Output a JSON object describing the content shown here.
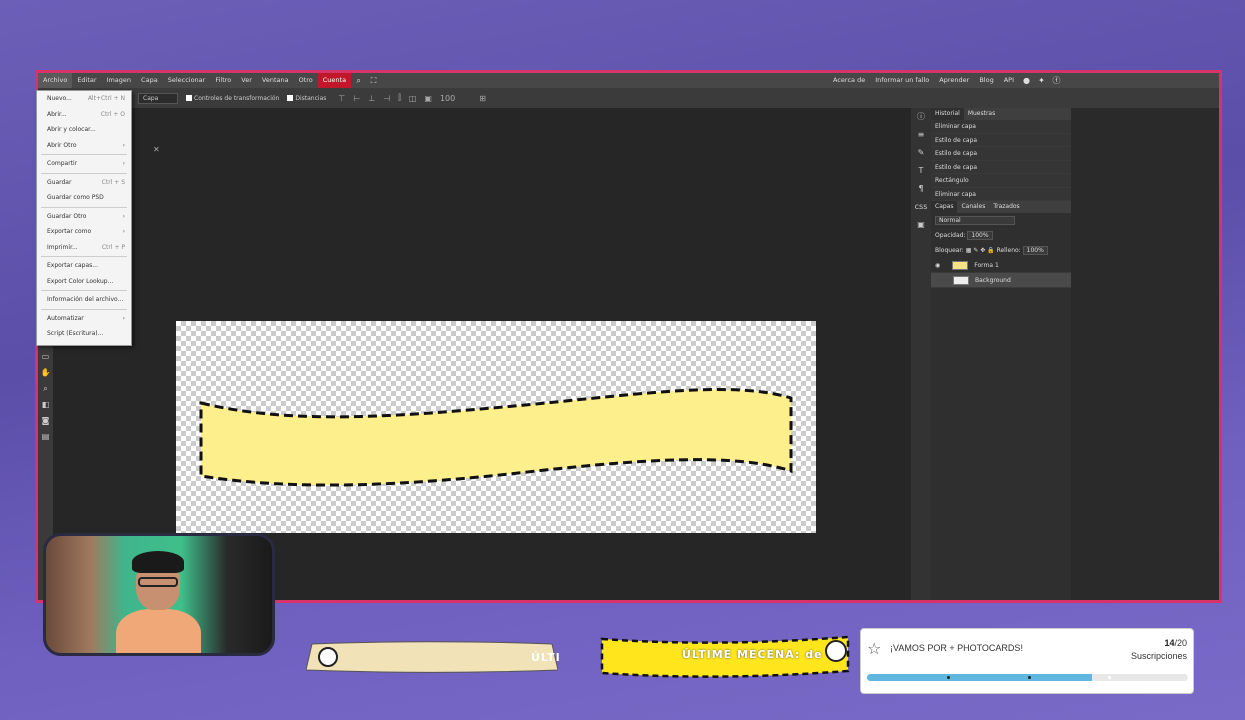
{
  "menubar": {
    "items": [
      "Archivo",
      "Editar",
      "Imagen",
      "Capa",
      "Seleccionar",
      "Filtro",
      "Ver",
      "Ventana",
      "Otro",
      "Cuenta"
    ],
    "right_links": [
      "Acerca de",
      "Informar un fallo",
      "Aprender",
      "Blog",
      "API"
    ]
  },
  "options_bar": {
    "layer_select": "Capa",
    "transform_controls": "Controles de transformación",
    "distances": "Distancias",
    "zoom": "100"
  },
  "file_menu": {
    "items": [
      {
        "label": "Nuevo...",
        "shortcut": "Alt+Ctrl + N"
      },
      {
        "label": "Abrir...",
        "shortcut": "Ctrl + O"
      },
      {
        "label": "Abrir y colocar...",
        "shortcut": ""
      },
      {
        "label": "Abrir Otro",
        "shortcut": "›"
      },
      {
        "label": "Compartir",
        "shortcut": "›"
      },
      {
        "label": "Guardar",
        "shortcut": "Ctrl + S"
      },
      {
        "label": "Guardar como PSD",
        "shortcut": ""
      },
      {
        "label": "Guardar Otro",
        "shortcut": "›"
      },
      {
        "label": "Exportar como",
        "shortcut": "›"
      },
      {
        "label": "Imprimir...",
        "shortcut": "Ctrl + P"
      },
      {
        "label": "Exportar capas...",
        "shortcut": ""
      },
      {
        "label": "Export Color Lookup...",
        "shortcut": ""
      },
      {
        "label": "Información del archivo...",
        "shortcut": ""
      },
      {
        "label": "Automatizar",
        "shortcut": "›"
      },
      {
        "label": "Script (Escritura)...",
        "shortcut": ""
      }
    ]
  },
  "history_panel": {
    "tabs": [
      "Historial",
      "Muestras"
    ],
    "entries": [
      "Eliminar capa",
      "Estilo de capa",
      "Estilo de capa",
      "Estilo de capa",
      "Rectángulo",
      "Eliminar capa"
    ]
  },
  "layers_panel": {
    "tabs": [
      "Capas",
      "Canales",
      "Trazados"
    ],
    "blend_mode": "Normal",
    "opacity_label": "Opacidad:",
    "opacity_value": "100%",
    "lock_label": "Bloquear:",
    "fill_label": "Relleno:",
    "fill_value": "100%",
    "layers": [
      "Forma 1",
      "Background"
    ]
  },
  "overlay": {
    "banner1_text": "ÚLTI",
    "banner2_text": "ÚLTIME MECENA: de",
    "goal_title": "¡VAMOS POR + PHOTOCARDS!",
    "goal_current": "14",
    "goal_total": "/20",
    "goal_label": "Suscripciones",
    "goal_progress": 0.7
  },
  "colors": {
    "frame_border": "#d6336b",
    "shape_fill": "#fdf08c",
    "banner2_fill": "#ffe61c",
    "progress_fill": "#5fb7e0"
  }
}
